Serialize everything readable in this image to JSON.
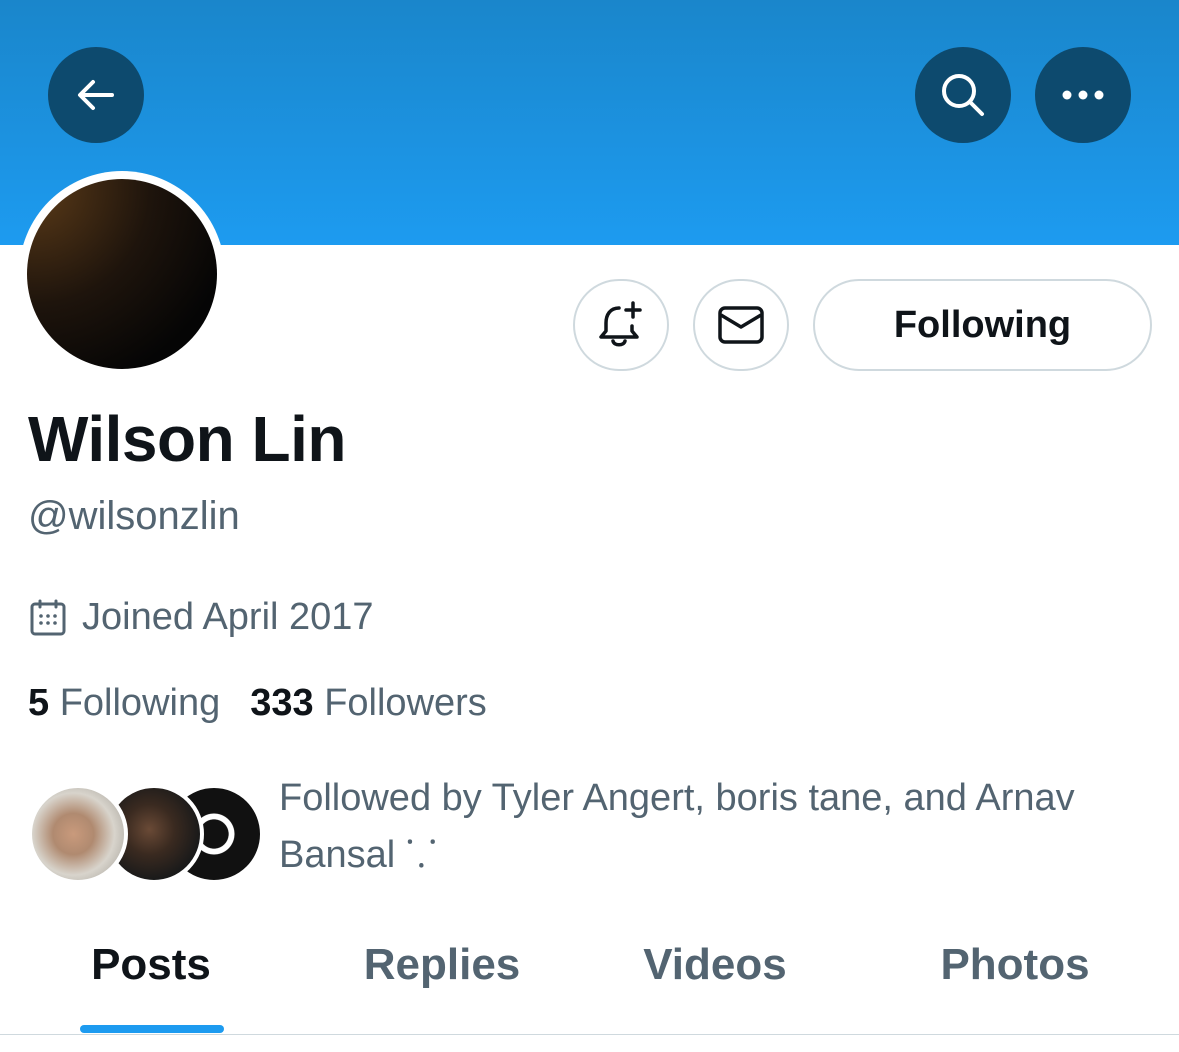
{
  "header": {
    "back_icon": "arrow-left-icon",
    "search_icon": "search-icon",
    "more_icon": "more-horizontal-icon",
    "banner_color": "#1d9bf0"
  },
  "profile": {
    "name": "Wilson Lin",
    "handle": "@wilsonzlin",
    "joined": "Joined April 2017",
    "following_count": "5",
    "following_label": "Following",
    "followers_count": "333",
    "followers_label": "Followers",
    "followed_by": "Followed by Tyler Angert, boris tane, and Arnav Bansal ⸪"
  },
  "actions": {
    "notify_icon": "bell-plus-icon",
    "message_icon": "envelope-icon",
    "follow_button_label": "Following"
  },
  "tabs": [
    {
      "label": "Posts",
      "active": true
    },
    {
      "label": "Replies",
      "active": false
    },
    {
      "label": "Videos",
      "active": false
    },
    {
      "label": "Photos",
      "active": false
    }
  ],
  "colors": {
    "accent": "#1d9bf0",
    "secondary_text": "#536471",
    "primary_text": "#0f1419"
  }
}
